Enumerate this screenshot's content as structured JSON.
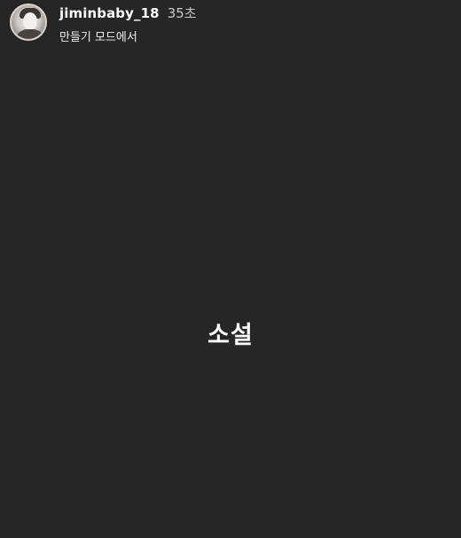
{
  "header": {
    "username": "jiminbaby_18",
    "time_ago": "35초",
    "subtitle": "만들기 모드에서"
  },
  "story": {
    "text": "소설"
  },
  "colors": {
    "background": "#262626",
    "text": "#ffffff",
    "muted": "#c9c9c9"
  }
}
